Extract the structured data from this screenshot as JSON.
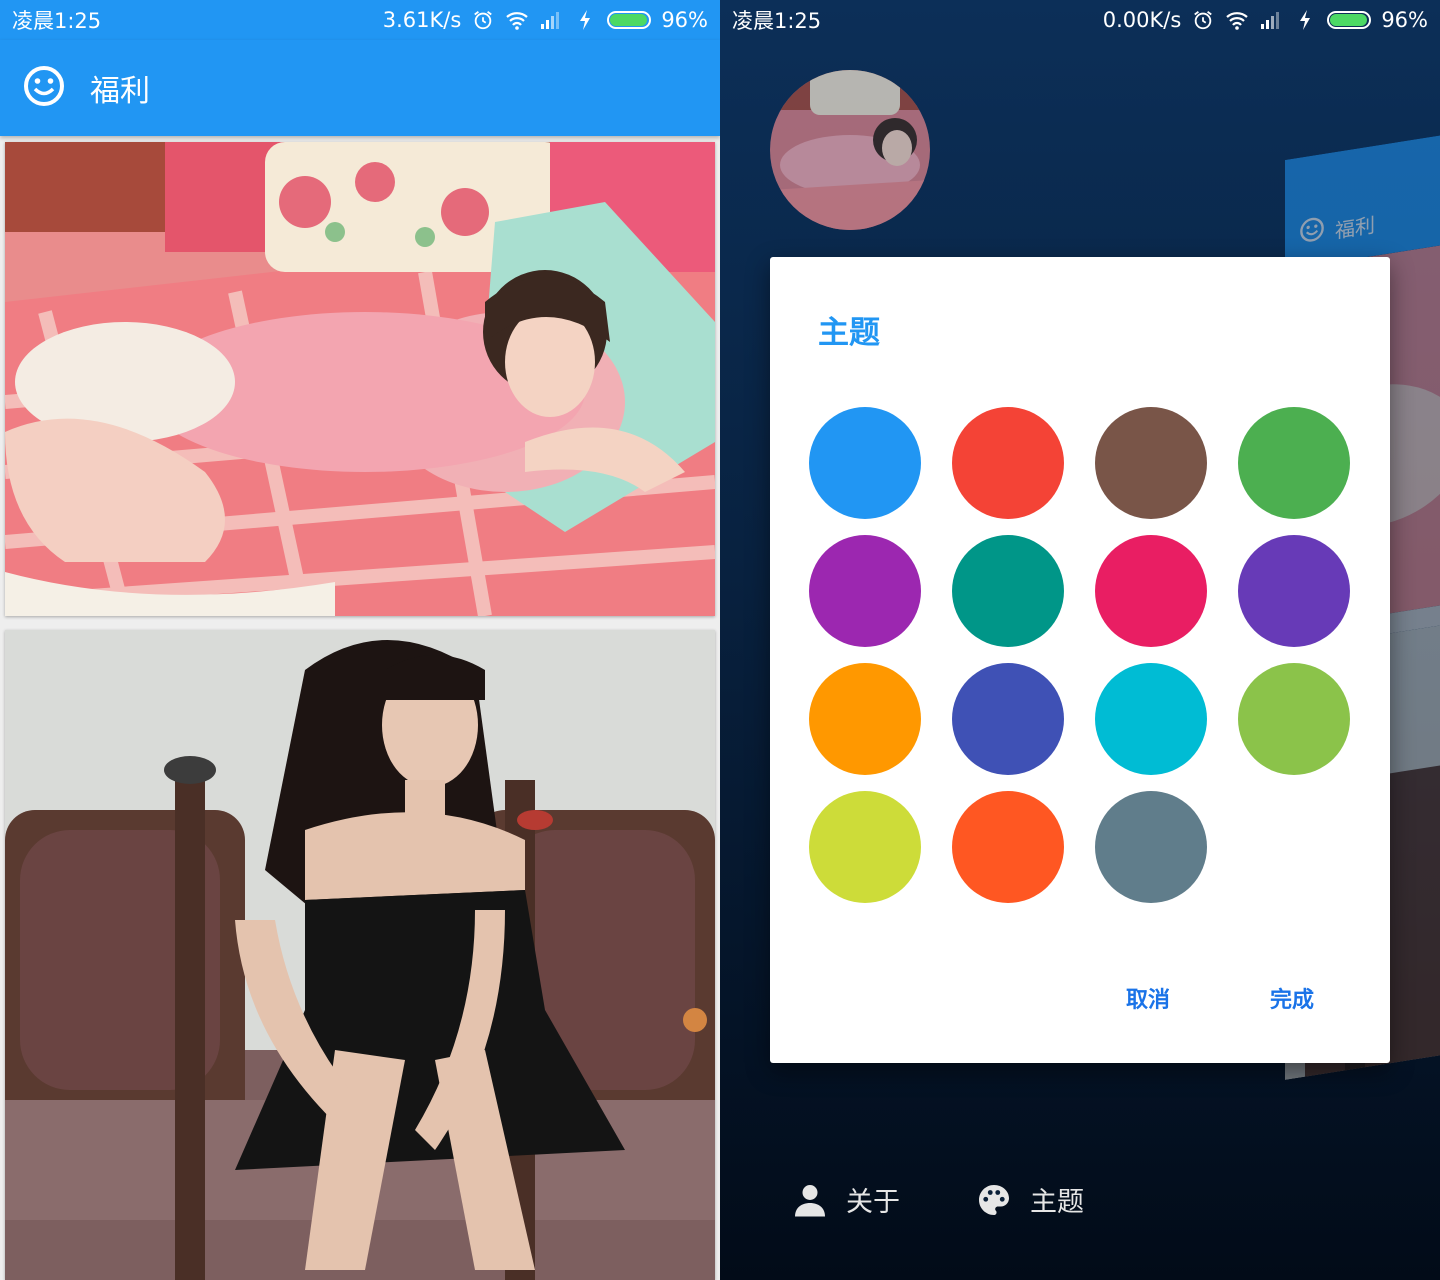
{
  "left_screen": {
    "status_bar": {
      "time": "凌晨1:25",
      "speed": "3.61K/s",
      "battery": "96%",
      "battery_level": 0.96
    },
    "toolbar": {
      "icon": "smiley-icon",
      "title": "福利"
    },
    "cards": [
      {
        "image": "photo-girl-lying-pink-bed"
      },
      {
        "image": "photo-girl-black-dress-bench"
      }
    ]
  },
  "right_screen": {
    "status_bar": {
      "time": "凌晨1:25",
      "speed": "0.00K/s",
      "battery": "96%",
      "battery_level": 0.96
    },
    "background_app": {
      "title": "福利"
    },
    "dialog": {
      "title": "主题",
      "colors": [
        "#2196F3",
        "#F44336",
        "#795548",
        "#4CAF50",
        "#9C27B0",
        "#009688",
        "#E91E63",
        "#673AB7",
        "#FF9800",
        "#3F51B5",
        "#00BCD4",
        "#8BC34A",
        "#CDDC39",
        "#FF5722",
        "#607D8B"
      ],
      "cancel_label": "取消",
      "done_label": "完成"
    },
    "menu": [
      {
        "icon": "person-icon",
        "label": "关于"
      },
      {
        "icon": "palette-icon",
        "label": "主题"
      }
    ]
  },
  "colors": {
    "primary": "#2196F3",
    "accent_text": "#1A73E8"
  }
}
